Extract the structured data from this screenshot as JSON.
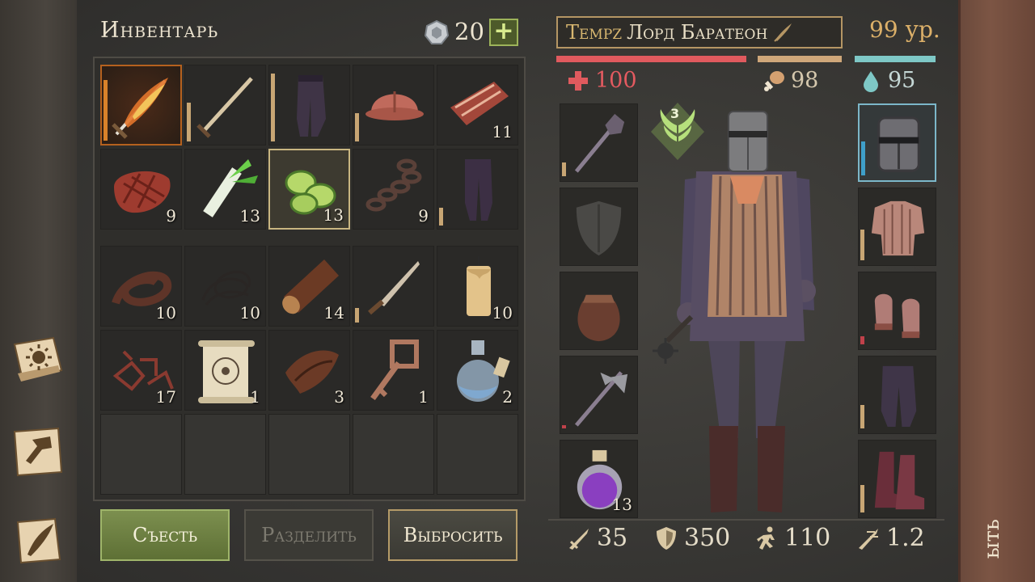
{
  "inventory": {
    "title": "Инвентарь",
    "coins": "20",
    "add_label": "+",
    "rows": [
      [
        {
          "icon": "flaming-sword-icon",
          "count": "",
          "dur": 0.85,
          "dur_color": "orange",
          "state": "fire"
        },
        {
          "icon": "sword-icon",
          "count": "",
          "dur": 0.55
        },
        {
          "icon": "pants-icon",
          "count": "",
          "dur": 0.95
        },
        {
          "icon": "helmet-icon",
          "count": "",
          "dur": 0.4
        },
        {
          "icon": "raw-meat-icon",
          "count": "11"
        }
      ],
      [
        {
          "icon": "steak-icon",
          "count": "9"
        },
        {
          "icon": "leek-icon",
          "count": "13"
        },
        {
          "icon": "cucumber-slices-icon",
          "count": "13",
          "state": "selected"
        },
        {
          "icon": "chain-icon",
          "count": "9"
        },
        {
          "icon": "leggings-icon",
          "count": "",
          "dur": 0.25
        }
      ],
      [
        {
          "icon": "leather-strap-icon",
          "count": "10"
        },
        {
          "icon": "rope-icon",
          "count": "10"
        },
        {
          "icon": "log-icon",
          "count": "14"
        },
        {
          "icon": "knife-icon",
          "count": "",
          "dur": 0.2
        },
        {
          "icon": "candle-icon",
          "count": "10"
        }
      ],
      [
        {
          "icon": "scrap-icon",
          "count": "17"
        },
        {
          "icon": "scroll-map-icon",
          "count": "1"
        },
        {
          "icon": "leather-icon",
          "count": "3"
        },
        {
          "icon": "key-icon",
          "count": "1"
        },
        {
          "icon": "potion-bottle-icon",
          "count": "2"
        }
      ],
      [
        {
          "icon": "",
          "count": ""
        },
        {
          "icon": "",
          "count": ""
        },
        {
          "icon": "",
          "count": ""
        },
        {
          "icon": "",
          "count": ""
        },
        {
          "icon": "",
          "count": ""
        }
      ]
    ],
    "buttons": {
      "eat": "Съесть",
      "split": "Разделить",
      "drop": "Выбросить"
    }
  },
  "character": {
    "clan_tag": "Tempz",
    "name": "Лорд Баратеон",
    "level": "99 ур.",
    "hp": "100",
    "food": "98",
    "water": "95",
    "wings_level": "3",
    "left_slots": [
      {
        "icon": "mace-icon",
        "count": "",
        "dur": 0.2
      },
      {
        "icon": "shield-placeholder-icon",
        "count": ""
      },
      {
        "icon": "pouch-icon",
        "count": ""
      },
      {
        "icon": "halberd-icon",
        "count": "",
        "dur": 0.05,
        "dur_color": "red"
      },
      {
        "icon": "purple-potion-icon",
        "count": "13"
      }
    ],
    "right_slots": [
      {
        "icon": "great-helm-icon",
        "count": "",
        "dur": 0.5,
        "dur_color": "blue",
        "state": "highlight"
      },
      {
        "icon": "chainmail-icon",
        "count": "",
        "dur": 0.45
      },
      {
        "icon": "mittens-icon",
        "count": "",
        "dur": 0.12,
        "dur_color": "red"
      },
      {
        "icon": "trousers-icon",
        "count": "",
        "dur": 0.35
      },
      {
        "icon": "boots-icon",
        "count": "",
        "dur": 0.4
      }
    ],
    "stats": {
      "attack": "35",
      "armor": "350",
      "speed": "110",
      "attack_speed": "1.2"
    }
  },
  "side_tab_label": "ыть",
  "colors": {
    "hp": "#e05a5e",
    "food": "#cfa77a",
    "water": "#7ec8c6",
    "level": "#dcb069",
    "eat_button": "#7c8f4f"
  }
}
